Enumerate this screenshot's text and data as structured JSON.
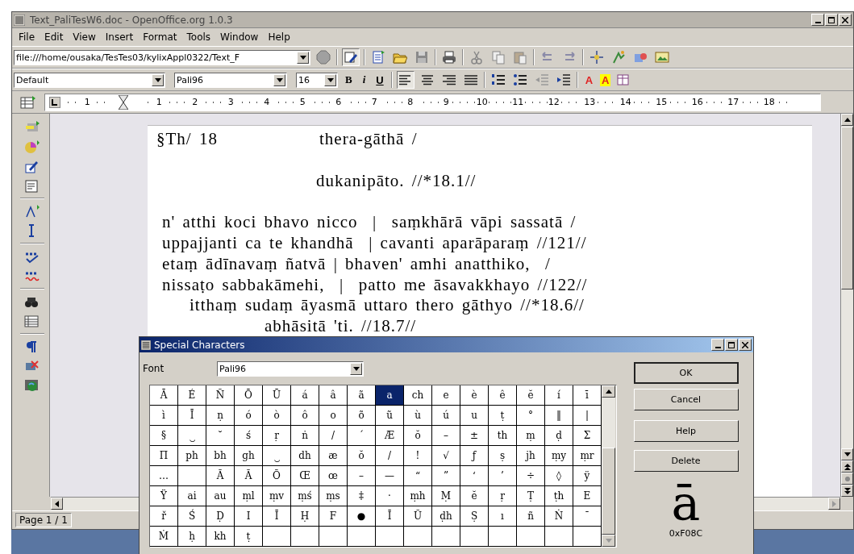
{
  "window": {
    "title": "Text_PaliTesW6.doc - OpenOffice.org 1.0.3"
  },
  "menu": [
    "File",
    "Edit",
    "View",
    "Insert",
    "Format",
    "Tools",
    "Window",
    "Help"
  ],
  "toolbar": {
    "url": "file:///home/ousaka/TesTes03/kylixAppl0322/Text_F"
  },
  "format_bar": {
    "style": "Default",
    "font": "Pali96",
    "size": "16",
    "text_buttons": [
      "B",
      "i",
      "U"
    ],
    "align": [
      {
        "kind": "left",
        "selected": true
      },
      {
        "kind": "center",
        "selected": false
      },
      {
        "kind": "right",
        "selected": false
      },
      {
        "kind": "justify",
        "selected": false
      }
    ],
    "font_color_label": "A",
    "highlight_label": "A"
  },
  "ruler": {
    "left_label": "1",
    "labels": [
      "1",
      "2",
      "3",
      "4",
      "5",
      "6",
      "7",
      "8",
      "9",
      "10",
      "11",
      "12",
      "13",
      "14",
      "15",
      "16",
      "17",
      "18"
    ]
  },
  "document": {
    "header_left": "§Th/ 18",
    "header_right": "thera-gāthā /",
    "lines": [
      {
        "kind": "heading",
        "text": "dukanipāto. //*18.1//"
      },
      {
        "kind": "verse",
        "text": "n' atthi koci bhavo nicco  |  saṃkhārā vāpi sassatā /"
      },
      {
        "kind": "verse",
        "text": "uppajjanti ca te khandhā  | cavanti aparāparaṃ //121//"
      },
      {
        "kind": "verse",
        "text": "etaṃ ādīnavaṃ ñatvā | bhaven' amhi anatthiko,  /"
      },
      {
        "kind": "verse",
        "text": "nissaṭo sabbakāmehi,  |  patto me āsavakkhayo //122//"
      },
      {
        "kind": "colophon",
        "text": "itthaṃ sudaṃ āyasmā uttaro thero gāthyo //*18.6//"
      },
      {
        "kind": "closing",
        "text": "abhāsitā 'ti. //18.7//"
      }
    ]
  },
  "status_bar": "Page 1 / 1",
  "dialog": {
    "title": "Special Characters",
    "font_label": "Font",
    "font": "Pali96",
    "rows": [
      [
        {
          "c": "Ā",
          "selected": false
        },
        {
          "c": "É",
          "selected": false
        },
        {
          "c": "Ñ",
          "selected": false
        },
        {
          "c": "Ō",
          "selected": false
        },
        {
          "c": "Ū",
          "selected": false
        },
        {
          "c": "á",
          "selected": false
        },
        {
          "c": "â",
          "selected": false
        },
        {
          "c": "ã",
          "selected": false
        },
        {
          "c": "a",
          "selected": true
        },
        {
          "c": "ch",
          "selected": false
        },
        {
          "c": "e",
          "selected": false
        },
        {
          "c": "è",
          "selected": false
        },
        {
          "c": "ê",
          "selected": false
        },
        {
          "c": "ĕ",
          "selected": false
        },
        {
          "c": "í",
          "selected": false
        },
        {
          "c": "ī",
          "selected": false
        }
      ],
      [
        {
          "c": "ì",
          "selected": false
        },
        {
          "c": "Ī",
          "selected": false
        },
        {
          "c": "ṇ",
          "selected": false
        },
        {
          "c": "ó",
          "selected": false
        },
        {
          "c": "ò",
          "selected": false
        },
        {
          "c": "ô",
          "selected": false
        },
        {
          "c": "o",
          "selected": false
        },
        {
          "c": "õ",
          "selected": false
        },
        {
          "c": "ũ",
          "selected": false
        },
        {
          "c": "ù",
          "selected": false
        },
        {
          "c": "ú",
          "selected": false
        },
        {
          "c": "u",
          "selected": false
        },
        {
          "c": "ṭ",
          "selected": false
        },
        {
          "c": "°",
          "selected": false
        },
        {
          "c": "‖",
          "selected": false
        },
        {
          "c": "|",
          "selected": false
        }
      ],
      [
        {
          "c": "§",
          "selected": false
        },
        {
          "c": "‿",
          "selected": false
        },
        {
          "c": "˘",
          "selected": false
        },
        {
          "c": "ś",
          "selected": false
        },
        {
          "c": "ṛ",
          "selected": false
        },
        {
          "c": "ṅ",
          "selected": false
        },
        {
          "c": "/",
          "selected": false
        },
        {
          "c": "´",
          "selected": false
        },
        {
          "c": "Æ",
          "selected": false
        },
        {
          "c": "ŏ",
          "selected": false
        },
        {
          "c": "–",
          "selected": false
        },
        {
          "c": "±",
          "selected": false
        },
        {
          "c": "th",
          "selected": false
        },
        {
          "c": "ṃ",
          "selected": false
        },
        {
          "c": "ḍ",
          "selected": false
        },
        {
          "c": "Σ",
          "selected": false
        }
      ],
      [
        {
          "c": "Π",
          "selected": false
        },
        {
          "c": "ph",
          "selected": false
        },
        {
          "c": "bh",
          "selected": false
        },
        {
          "c": "gh",
          "selected": false
        },
        {
          "c": "‿",
          "selected": false
        },
        {
          "c": "dh",
          "selected": false
        },
        {
          "c": "æ",
          "selected": false
        },
        {
          "c": "ŏ",
          "selected": false
        },
        {
          "c": "/",
          "selected": false
        },
        {
          "c": "!",
          "selected": false
        },
        {
          "c": "√",
          "selected": false
        },
        {
          "c": "ƒ",
          "selected": false
        },
        {
          "c": "ṣ",
          "selected": false
        },
        {
          "c": "jh",
          "selected": false
        },
        {
          "c": "ṃy",
          "selected": false
        },
        {
          "c": "ṃr",
          "selected": false
        }
      ],
      [
        {
          "c": "…",
          "selected": false
        },
        null,
        {
          "c": "Ã",
          "selected": false
        },
        {
          "c": "Ã",
          "selected": false
        },
        {
          "c": "Õ",
          "selected": false
        },
        {
          "c": "Œ",
          "selected": false
        },
        {
          "c": "œ",
          "selected": false
        },
        {
          "c": "–",
          "selected": false
        },
        {
          "c": "—",
          "selected": false
        },
        {
          "c": "“",
          "selected": false
        },
        {
          "c": "”",
          "selected": false
        },
        {
          "c": "‘",
          "selected": false
        },
        {
          "c": "’",
          "selected": false
        },
        {
          "c": "÷",
          "selected": false
        },
        {
          "c": "◊",
          "selected": false
        },
        {
          "c": "ÿ",
          "selected": false
        }
      ],
      [
        {
          "c": "Ÿ",
          "selected": false
        },
        {
          "c": "ai",
          "selected": false
        },
        {
          "c": "au",
          "selected": false
        },
        {
          "c": "ṃl",
          "selected": false
        },
        {
          "c": "ṃv",
          "selected": false
        },
        {
          "c": "ṃś",
          "selected": false
        },
        {
          "c": "ṃs",
          "selected": false
        },
        {
          "c": "‡",
          "selected": false
        },
        {
          "c": "·",
          "selected": false
        },
        {
          "c": "ṃh",
          "selected": false
        },
        {
          "c": "Ṃ",
          "selected": false
        },
        {
          "c": "ĕ",
          "selected": false
        },
        {
          "c": "ṛ",
          "selected": false
        },
        {
          "c": "Ṭ",
          "selected": false
        },
        {
          "c": "ṭh",
          "selected": false
        },
        {
          "c": "E",
          "selected": false
        }
      ],
      [
        {
          "c": "ř",
          "selected": false
        },
        {
          "c": "Ś",
          "selected": false
        },
        {
          "c": "Ḍ",
          "selected": false
        },
        {
          "c": "I",
          "selected": false
        },
        {
          "c": "Ī",
          "selected": false
        },
        {
          "c": "Ḥ",
          "selected": false
        },
        {
          "c": "F",
          "selected": false
        },
        {
          "c": "●",
          "selected": false
        },
        {
          "c": "Ī",
          "selected": false
        },
        {
          "c": "Ũ",
          "selected": false
        },
        {
          "c": "ḍh",
          "selected": false
        },
        {
          "c": "Ṣ",
          "selected": false
        },
        {
          "c": "ı",
          "selected": false
        },
        {
          "c": "ñ",
          "selected": false
        },
        {
          "c": "Ṅ",
          "selected": false
        },
        {
          "c": "ˉ",
          "selected": false
        }
      ],
      [
        {
          "c": "Ṁ",
          "selected": false
        },
        {
          "c": "ḥ",
          "selected": false
        },
        {
          "c": "kh",
          "selected": false
        },
        {
          "c": "ṭ",
          "selected": false
        }
      ]
    ],
    "buttons": [
      "OK",
      "Cancel",
      "Help",
      "Delete"
    ],
    "preview": "ā",
    "code": "0xF08C"
  }
}
